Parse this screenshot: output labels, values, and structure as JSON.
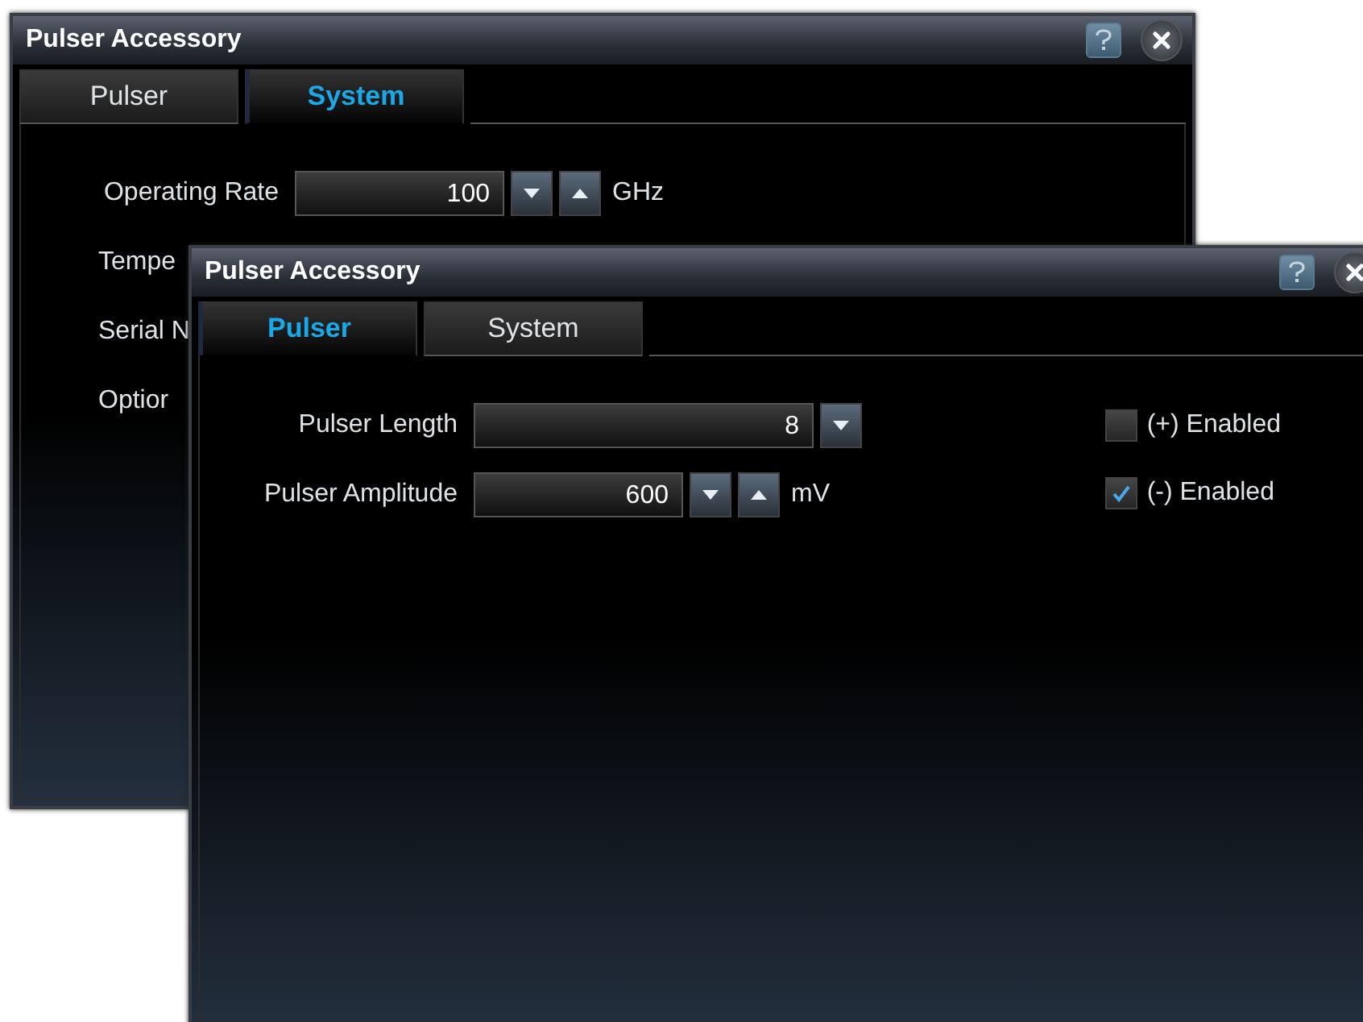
{
  "windows": [
    {
      "title": "Pulser Accessory",
      "tabs": [
        {
          "label": "Pulser",
          "selected": false
        },
        {
          "label": "System",
          "selected": true
        }
      ],
      "fields": [
        {
          "kind": "spinner",
          "label": "Operating Rate",
          "value": "100",
          "unit": "GHz"
        },
        {
          "kind": "cut",
          "label": "Tempe"
        },
        {
          "kind": "cut",
          "label": "Serial N"
        },
        {
          "kind": "cut",
          "label": "Optior"
        }
      ]
    },
    {
      "title": "Pulser Accessory",
      "tabs": [
        {
          "label": "Pulser",
          "selected": true
        },
        {
          "label": "System",
          "selected": false
        }
      ],
      "fields": [
        {
          "kind": "dropdown",
          "label": "Pulser Length",
          "value": "8"
        },
        {
          "kind": "spinner",
          "label": "Pulser Amplitude",
          "value": "600",
          "unit": "mV"
        }
      ],
      "checkboxes": [
        {
          "label": "(+) Enabled",
          "checked": false
        },
        {
          "label": "(-) Enabled",
          "checked": true
        }
      ]
    }
  ]
}
